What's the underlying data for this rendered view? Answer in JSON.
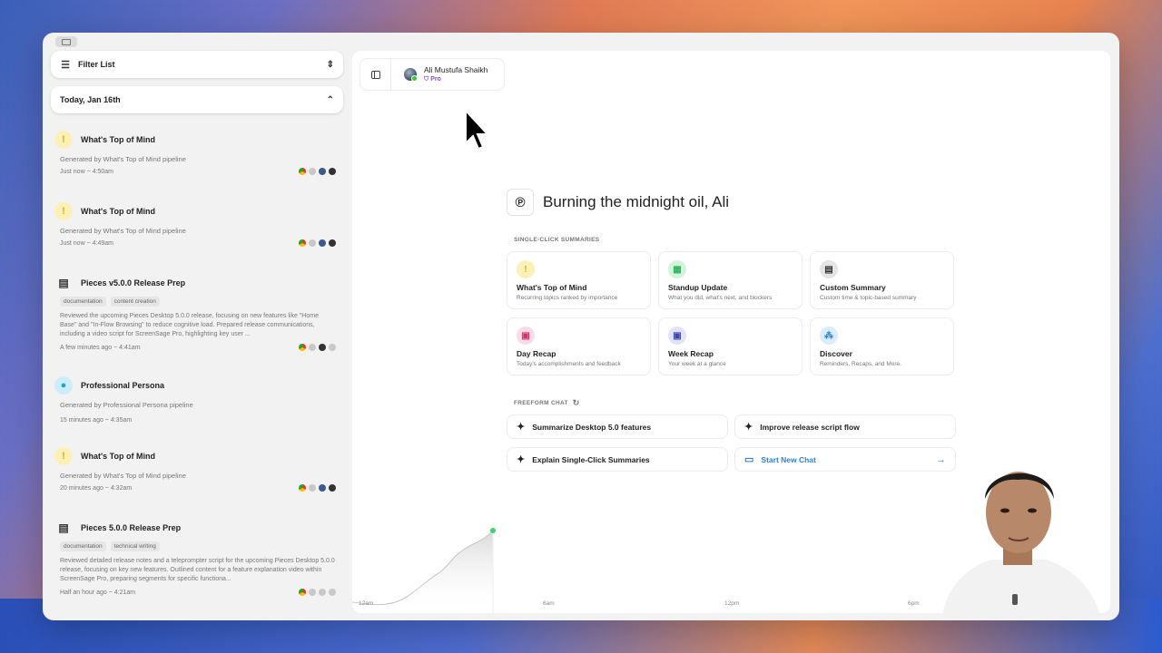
{
  "sidebar": {
    "filter_label": "Filter List",
    "date_label": "Today, Jan 16th",
    "items": [
      {
        "title": "What's Top of Mind",
        "sub": "Generated by What's Top of Mind pipeline",
        "time": "Just now ~ 4:50am",
        "icon": "warning-icon"
      },
      {
        "title": "What's Top of Mind",
        "sub": "Generated by What's Top of Mind pipeline",
        "time": "Just now ~ 4:49am",
        "icon": "warning-icon"
      },
      {
        "title": "Pieces v5.0.0 Release Prep",
        "tags": [
          "documentation",
          "content creation"
        ],
        "desc": "Reviewed the upcoming Pieces Desktop 5.0.0 release, focusing on new features like \"Home Base\" and \"In-Flow Browsing\" to reduce cognitive load. Prepared release communications, including a video script for ScreenSage Pro, highlighting key user ...",
        "time": "A few minutes ago ~ 4:41am",
        "icon": "document-icon"
      },
      {
        "title": "Professional Persona",
        "sub": "Generated by Professional Persona pipeline",
        "time": "15 minutes ago ~ 4:35am",
        "icon": "person-icon"
      },
      {
        "title": "What's Top of Mind",
        "sub": "Generated by What's Top of Mind pipeline",
        "time": "20 minutes ago ~ 4:32am",
        "icon": "warning-icon"
      },
      {
        "title": "Pieces 5.0.0 Release Prep",
        "tags": [
          "documentation",
          "technical writing"
        ],
        "desc": "Reviewed detailed release notes and a teleprompter script for the upcoming Pieces Desktop 5.0.0 release, focusing on key new features. Outlined content for a feature explanation video within ScreenSage Pro, preparing segments for specific functiona...",
        "time": "Half an hour ago ~ 4:21am",
        "icon": "document-icon"
      }
    ]
  },
  "user": {
    "name": "Ali Mustufa Shaikh",
    "plan": "Pro"
  },
  "greeting": "Burning the midnight oil, Ali",
  "summaries": {
    "label": "SINGLE-CLICK SUMMARIES",
    "cards": [
      {
        "title": "What's Top of Mind",
        "sub": "Recurring topics ranked by importance",
        "color": "#fbf1b8",
        "fg": "#d8b400",
        "glyph": "!"
      },
      {
        "title": "Standup Update",
        "sub": "What you did, what's next, and blockers",
        "color": "#d4f3dd",
        "fg": "#30b35a",
        "glyph": "▦"
      },
      {
        "title": "Custom Summary",
        "sub": "Custom time & topic-based summary",
        "color": "#e4e4e4",
        "fg": "#333333",
        "glyph": "▤"
      },
      {
        "title": "Day Recap",
        "sub": "Today's accomplishments and feedback",
        "color": "#fbdbe6",
        "fg": "#d0316a",
        "glyph": "▣"
      },
      {
        "title": "Week Recap",
        "sub": "Your week at a glance",
        "color": "#e2e3f7",
        "fg": "#3c46b3",
        "glyph": "▣"
      },
      {
        "title": "Discover",
        "sub": "Reminders, Recaps, and More.",
        "color": "#dcecfb",
        "fg": "#2e82d0",
        "glyph": "⁂"
      }
    ]
  },
  "freeform": {
    "label": "FREEFORM CHAT",
    "chips": [
      "Summarize Desktop 5.0 features",
      "Improve release script flow",
      "Explain Single-Click Summaries"
    ],
    "new_chat": "Start New Chat"
  },
  "chart_data": {
    "type": "area",
    "x_ticks": [
      "12am",
      "6am",
      "12pm",
      "6pm"
    ],
    "title": "",
    "xlabel": "",
    "ylabel": ""
  }
}
